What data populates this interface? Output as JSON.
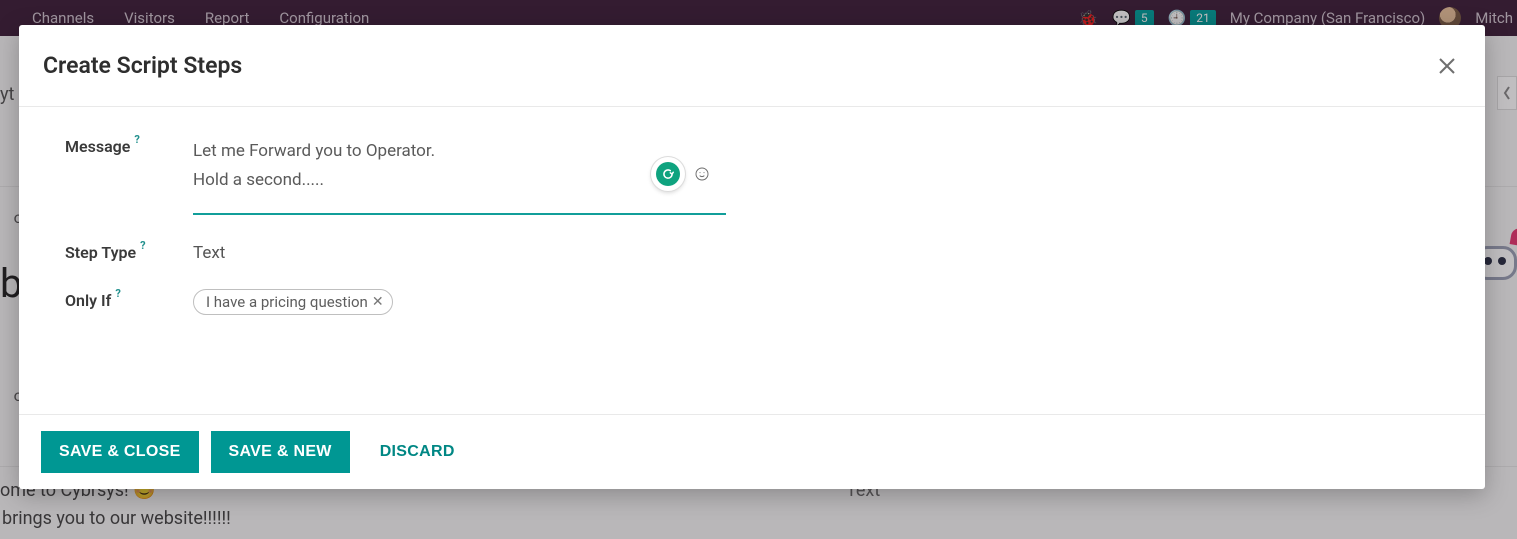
{
  "topnav": {
    "items": [
      "Channels",
      "Visitors",
      "Report",
      "Configuration"
    ],
    "chat_count": "5",
    "activity_count": "21",
    "company": "My Company (San Francisco)",
    "user": "Mitch"
  },
  "background": {
    "record_fragment_left": "yt",
    "big_fragment": "b",
    "ot_fragment": "ot",
    "welcome_line1": "ome to Cybrsys! 😊",
    "welcome_line2": "brings you to our website!!!!!!",
    "type_text": "Text"
  },
  "modal": {
    "title": "Create Script Steps",
    "labels": {
      "message": "Message",
      "step_type": "Step Type",
      "only_if": "Only If"
    },
    "help_indicator": "?",
    "message_value": "Let me Forward you to Operator.\nHold a second.....",
    "step_type_value": "Text",
    "only_if_tag": "I have a pricing question",
    "buttons": {
      "save_close": "SAVE & CLOSE",
      "save_new": "SAVE & NEW",
      "discard": "DISCARD"
    }
  },
  "icons": {
    "close": "close-icon",
    "grammarly": "grammarly-icon",
    "emoji": "emoji-picker-icon",
    "bug": "debug-icon",
    "chat": "conversations-icon",
    "clock": "activities-icon"
  }
}
